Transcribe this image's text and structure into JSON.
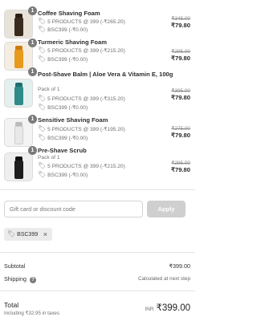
{
  "items": [
    {
      "qty": "1",
      "name": "Coffee Shaving Foam",
      "variant": "",
      "discounts": [
        "5 PRODUCTS @ 399 (-₹265.20)",
        "BSC399 (-₹0.00)"
      ],
      "old_price": "₹345.00",
      "new_price": "₹79.80",
      "thumb_color": "#3b2a1e",
      "thumb_bg": "#e9e2d8"
    },
    {
      "qty": "1",
      "name": "Turmeric Shaving Foam",
      "variant": "",
      "discounts": [
        "5 PRODUCTS @ 399 (-₹215.20)",
        "BSC399 (-₹0.00)"
      ],
      "old_price": "₹295.00",
      "new_price": "₹79.80",
      "thumb_color": "#e89a1c",
      "thumb_bg": "#f5ede2"
    },
    {
      "qty": "1",
      "name": "Post-Shave Balm | Aloe Vera & Vitamin E, 100g",
      "variant": "Pack of 1",
      "discounts": [
        "5 PRODUCTS @ 399 (-₹315.20)",
        "BSC399 (-₹0.00)"
      ],
      "old_price": "₹395.00",
      "new_price": "₹79.80",
      "thumb_color": "#2f8a8a",
      "thumb_bg": "#e4f0ee"
    },
    {
      "qty": "1",
      "name": "Sensitive Shaving Foam",
      "variant": "",
      "discounts": [
        "5 PRODUCTS @ 399 (-₹195.20)",
        "BSC399 (-₹0.00)"
      ],
      "old_price": "₹275.00",
      "new_price": "₹79.80",
      "thumb_color": "#e8e8e8",
      "thumb_bg": "#f3f3f3"
    },
    {
      "qty": "1",
      "name": "Pre-Shave Scrub",
      "variant": "Pack of 1",
      "discounts": [
        "5 PRODUCTS @ 399 (-₹215.20)",
        "BSC399 (-₹0.00)"
      ],
      "old_price": "₹295.00",
      "new_price": "₹79.80",
      "thumb_color": "#1d1d1d",
      "thumb_bg": "#eeeeee"
    }
  ],
  "discount_form": {
    "placeholder": "Gift card or discount code",
    "value": "",
    "apply_label": "Apply"
  },
  "applied_code": {
    "label": "BSC399",
    "remove_icon": "×"
  },
  "summary": {
    "subtotal_label": "Subtotal",
    "subtotal_value": "₹399.00",
    "shipping_label": "Shipping",
    "shipping_help_icon": "?",
    "shipping_value": "Calculated at next step",
    "total_label": "Total",
    "taxes_note": "Including ₹32.95 in taxes",
    "currency": "INR",
    "total_value": "₹399.00"
  },
  "icons": {
    "tag": "🏷"
  },
  "colors": {
    "apply_button": "#cfcfcf",
    "chip_bg": "#ebebeb",
    "qty_badge": "#7a7a7a"
  }
}
